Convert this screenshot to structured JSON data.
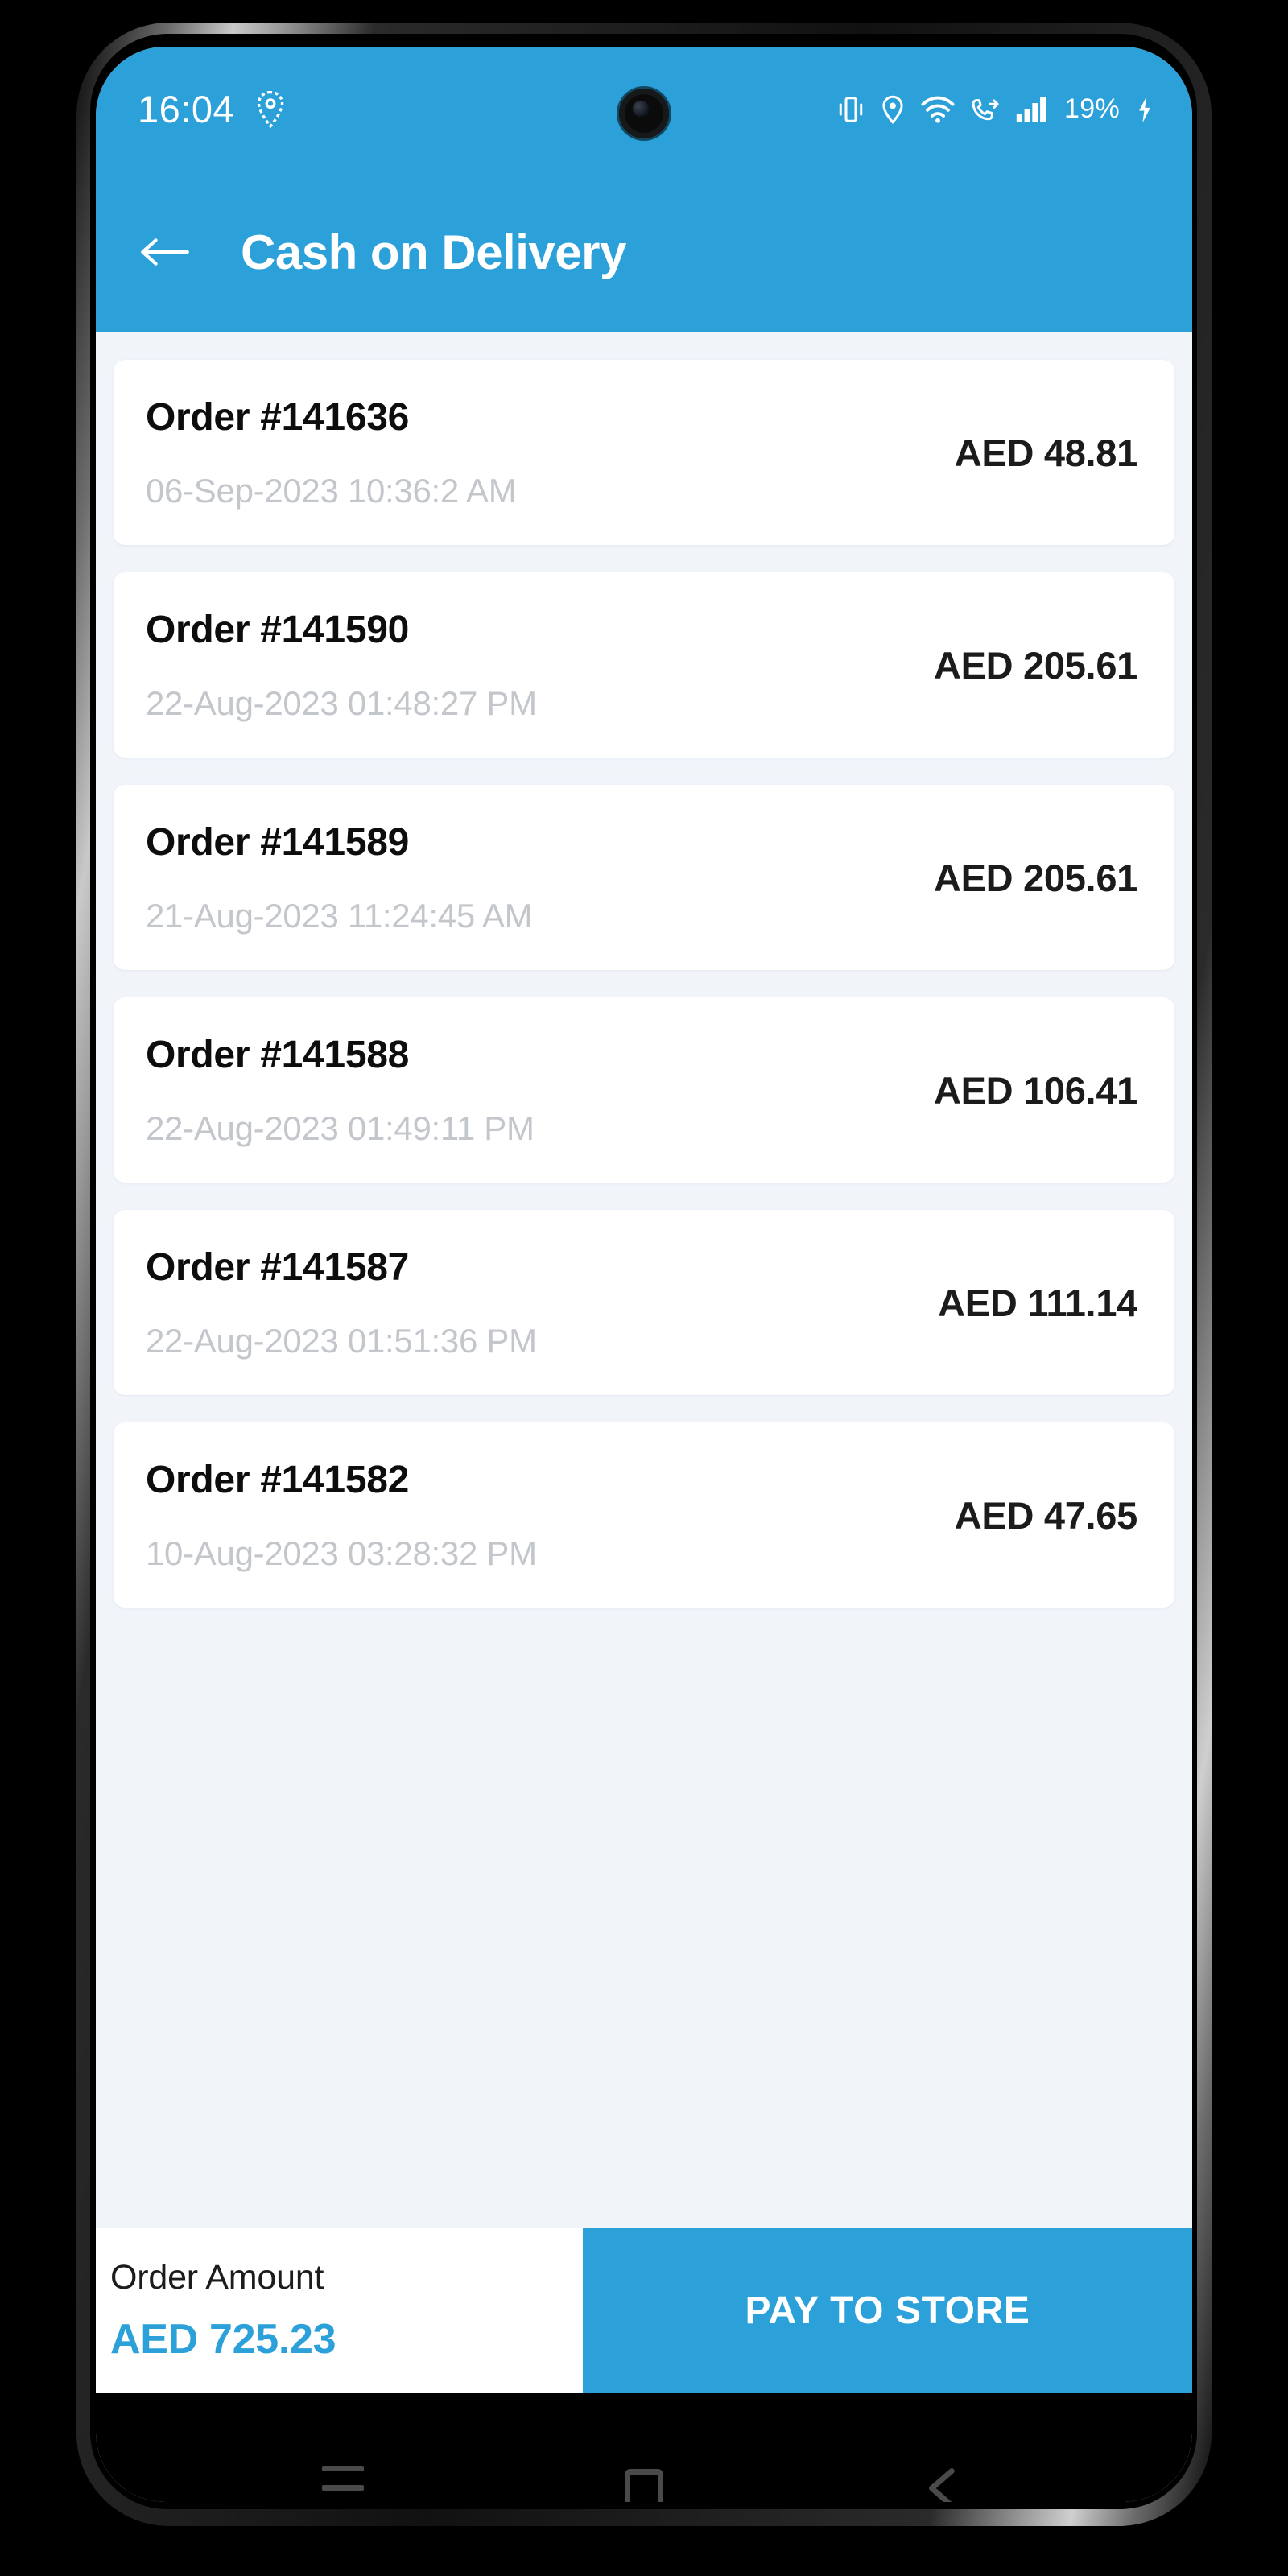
{
  "status_bar": {
    "time": "16:04",
    "battery_percent": "19%",
    "icons": [
      "location-pin-icon",
      "vibrate-icon",
      "location-icon",
      "wifi-icon",
      "call-forward-icon",
      "signal-bars-icon",
      "battery-charging-icon"
    ]
  },
  "app_bar": {
    "back_label": "back-arrow-icon",
    "title": "Cash on Delivery"
  },
  "orders": [
    {
      "id": "Order #141636",
      "date": "06-Sep-2023 10:36:2 AM",
      "amount": "AED 48.81"
    },
    {
      "id": "Order #141590",
      "date": "22-Aug-2023 01:48:27 PM",
      "amount": "AED 205.61"
    },
    {
      "id": "Order #141589",
      "date": "21-Aug-2023 11:24:45 AM",
      "amount": "AED 205.61"
    },
    {
      "id": "Order #141588",
      "date": "22-Aug-2023 01:49:11 PM",
      "amount": "AED 106.41"
    },
    {
      "id": "Order #141587",
      "date": "22-Aug-2023 01:51:36 PM",
      "amount": "AED 111.14"
    },
    {
      "id": "Order #141582",
      "date": "10-Aug-2023 03:28:32 PM",
      "amount": "AED 47.65"
    }
  ],
  "bottom_bar": {
    "order_amount_label": "Order Amount",
    "order_amount_value": "AED 725.23",
    "pay_button_label": "PAY TO STORE"
  },
  "nav_bar": {
    "recents": "menu-icon",
    "home": "home-square-icon",
    "back": "back-triangle-icon"
  },
  "colors": {
    "accent": "#2BA0D9",
    "page_bg": "#F1F5FA",
    "card_bg": "#FFFFFF",
    "date_text": "#C3C7CC",
    "title_text": "#0D0D0D"
  }
}
